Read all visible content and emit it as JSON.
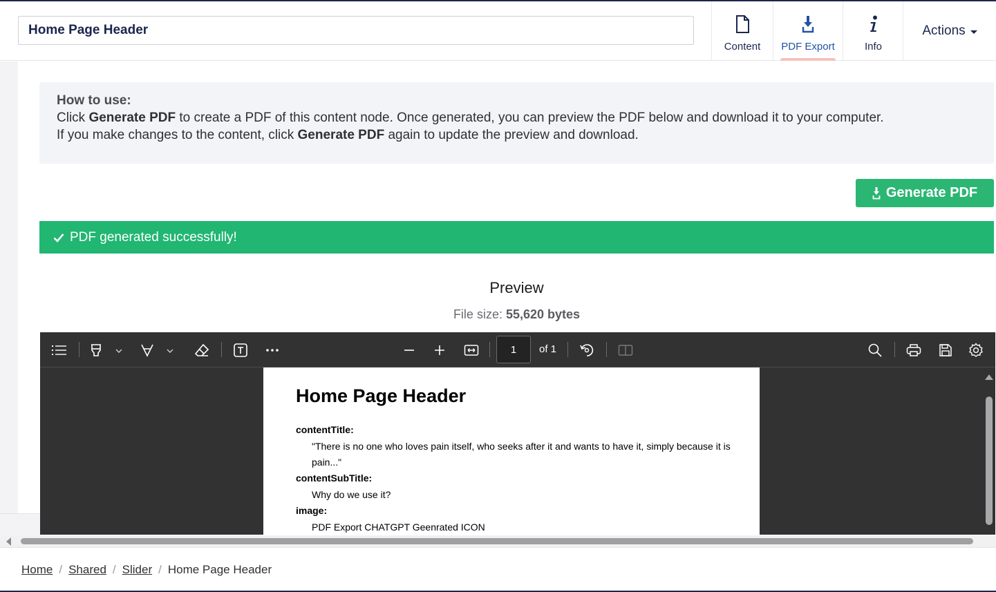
{
  "header": {
    "name_value": "Home Page Header",
    "tabs": [
      {
        "label": "Content",
        "icon": "document-icon"
      },
      {
        "label": "PDF Export",
        "icon": "download-icon",
        "active": true
      },
      {
        "label": "Info",
        "icon": "info-icon"
      }
    ],
    "actions_label": "Actions"
  },
  "howto": {
    "title": "How to use:",
    "line1_pre": "Click ",
    "line1_bold": "Generate PDF",
    "line1_post": " to create a PDF of this content node. Once generated, you can preview the PDF below and download it to your computer.",
    "line2_pre": "If you make changes to the content, click ",
    "line2_bold": "Generate PDF",
    "line2_post": " again to update the preview and download."
  },
  "generate_button": "Generate PDF",
  "success_message": "PDF generated successfully!",
  "preview": {
    "title": "Preview",
    "filesize_label": "File size:",
    "filesize_value": "55,620 bytes"
  },
  "viewer": {
    "page_number": "1",
    "page_of": "of 1",
    "colors": {
      "toolbar_bg": "#323233",
      "page_bg": "#ffffff"
    }
  },
  "pdf_page": {
    "heading": "Home Page Header",
    "fields": [
      {
        "label": "contentTitle:",
        "value": "\"There is no one who loves pain itself, who seeks after it and wants to have it, simply because it is pain...\""
      },
      {
        "label": "contentSubTitle:",
        "value": "Why do we use it?"
      },
      {
        "label": "image:",
        "value": "PDF Export CHATGPT Geenrated ICON"
      }
    ]
  },
  "breadcrumb": {
    "items": [
      "Home",
      "Shared",
      "Slider"
    ],
    "current": "Home Page Header"
  },
  "colors": {
    "accent_green": "#2bb673",
    "success_green": "#21b672",
    "brand_navy": "#1b264f",
    "active_tab_text": "#2152a3",
    "active_tab_indicator": "#f5c1bc"
  }
}
